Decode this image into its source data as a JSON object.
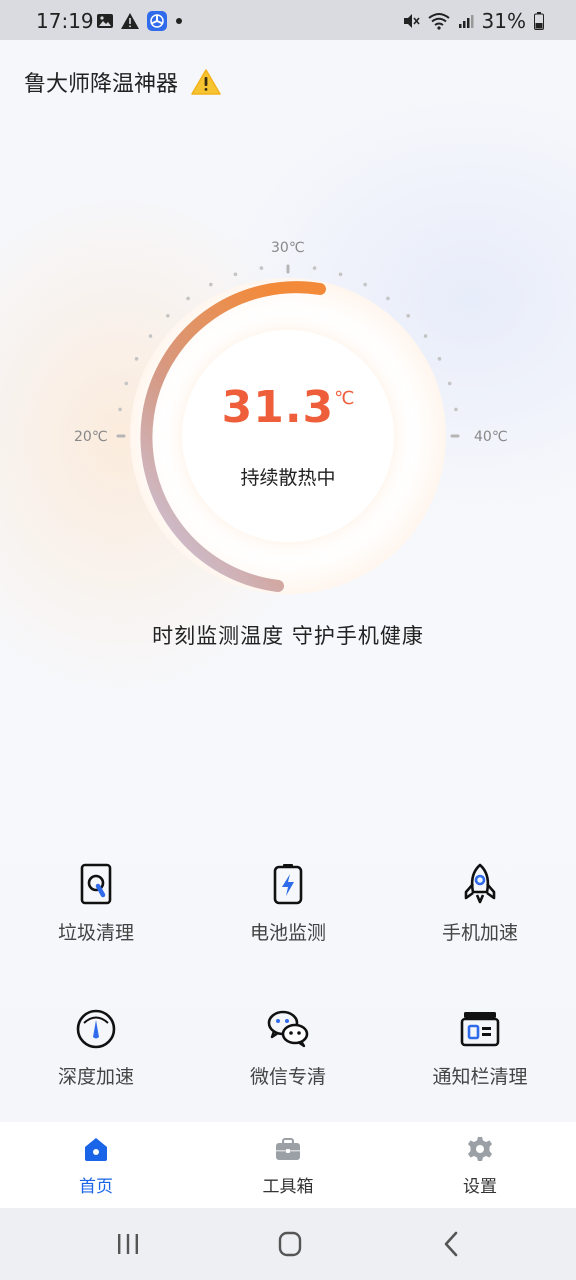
{
  "status_bar": {
    "time": "17:19",
    "battery_percent": "31%"
  },
  "app": {
    "title": "鲁大师降温神器",
    "warning_icon": "warning-icon"
  },
  "gauge": {
    "temperature": "31.3",
    "unit": "℃",
    "status": "持续散热中",
    "tick_min": "20℃",
    "tick_mid": "30℃",
    "tick_max": "40℃",
    "range": [
      20,
      40
    ],
    "value": 31.3,
    "accent_start": "#f28a3a",
    "accent_end": "#c9c9ee"
  },
  "slogan": "时刻监测温度 守护手机健康",
  "tools": [
    {
      "label": "垃圾清理",
      "icon": "trash-clean-icon"
    },
    {
      "label": "电池监测",
      "icon": "battery-icon"
    },
    {
      "label": "手机加速",
      "icon": "rocket-icon"
    },
    {
      "label": "深度加速",
      "icon": "speedometer-icon"
    },
    {
      "label": "微信专清",
      "icon": "wechat-icon"
    },
    {
      "label": "通知栏清理",
      "icon": "notification-bar-icon"
    }
  ],
  "bottom_nav": [
    {
      "label": "首页",
      "icon": "home-icon",
      "active": true
    },
    {
      "label": "工具箱",
      "icon": "toolbox-icon",
      "active": false
    },
    {
      "label": "设置",
      "icon": "settings-icon",
      "active": false
    }
  ],
  "colors": {
    "accent_blue": "#1a64e8",
    "temperature_text": "#ef5e3a"
  }
}
